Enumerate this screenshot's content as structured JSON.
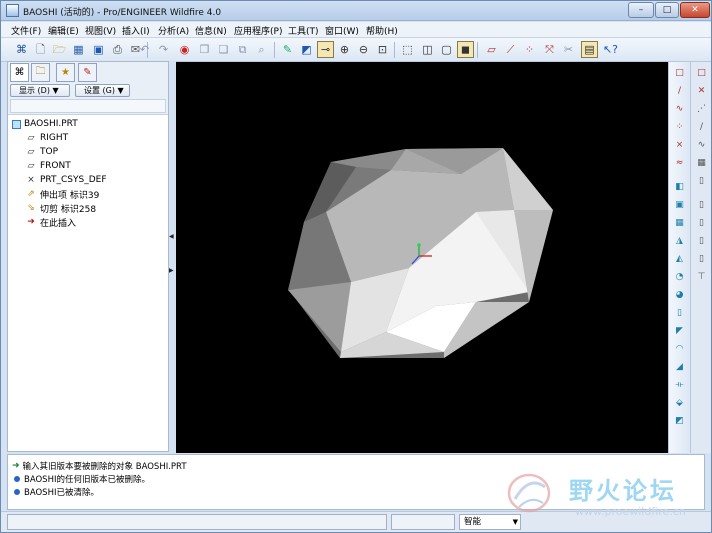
{
  "window": {
    "title": "BAOSHI (活动的) - Pro/ENGINEER Wildfire 4.0",
    "controls": {
      "minimize": "–",
      "maximize": "□",
      "close": "✕"
    }
  },
  "menu": [
    "文件(F)",
    "编辑(E)",
    "视图(V)",
    "插入(I)",
    "分析(A)",
    "信息(N)",
    "应用程序(P)",
    "工具(T)",
    "窗口(W)",
    "帮助(H)"
  ],
  "navigator": {
    "display_dropdown": "显示 (D) ▼",
    "settings_dropdown": "设置 (G) ▼",
    "tree": [
      {
        "label": "BAOSHI.PRT",
        "icon": "part-icon"
      },
      {
        "label": "RIGHT",
        "icon": "datum-plane-icon"
      },
      {
        "label": "TOP",
        "icon": "datum-plane-icon"
      },
      {
        "label": "FRONT",
        "icon": "datum-plane-icon"
      },
      {
        "label": "PRT_CSYS_DEF",
        "icon": "coordinate-system-icon"
      },
      {
        "label": "伸出项 标识39",
        "icon": "protrusion-icon"
      },
      {
        "label": "切剪 标识258",
        "icon": "cut-icon"
      },
      {
        "label": "在此插入",
        "icon": "insert-here-arrow-icon"
      }
    ]
  },
  "messages": [
    {
      "text": "输入其旧版本要被删除的对象    BAOSHI.PRT",
      "kind": "prompt"
    },
    {
      "text": "BAOSHI的任何旧版本已被删除。",
      "kind": "info"
    },
    {
      "text": "BAOSHI已被清除。",
      "kind": "info"
    }
  ],
  "status": {
    "filter_selected": "智能"
  },
  "watermark": {
    "brand": "野火论坛",
    "url": "www.proewildfire.cn"
  },
  "colors": {
    "viewport_background": "#000000",
    "chrome": "#d4e2f2",
    "accent": "#2b64c8"
  }
}
